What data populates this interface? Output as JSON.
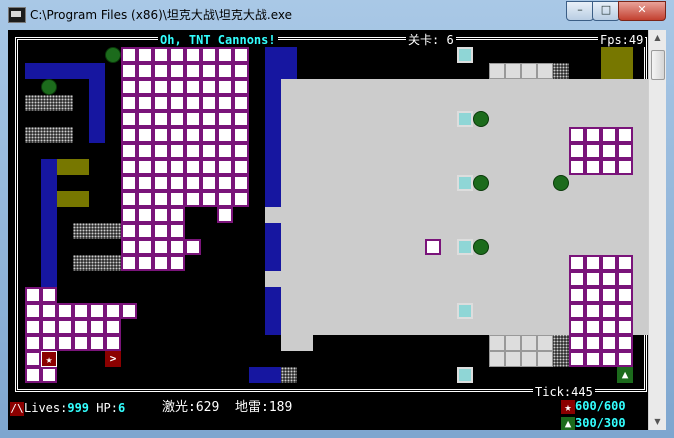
{
  "window": {
    "title": "C:\\Program Files (x86)\\坦克大战\\坦克大战.exe",
    "controls": {
      "minimize": "–",
      "maximize": "□",
      "close": "✕"
    }
  },
  "game": {
    "level_name": "Oh, TNT Cannons!",
    "level_label": "关卡:",
    "level_value": "6",
    "fps_text": "Fps:49",
    "tick_text": "Tick:445"
  },
  "status": {
    "lives_label": "Lives:",
    "lives_value": "999",
    "hp_label": "HP:",
    "hp_value": "6",
    "laser_text": "激光:629",
    "mine_text": "地雷:189",
    "star_ammo_text": "600/600",
    "tank_ammo_text": "300/300"
  },
  "colors": {
    "background": "#000000",
    "hud_cyan": "#33ffff",
    "brick_border": "#7a147a",
    "water": "#1616a0",
    "enemy_base": "#777700",
    "grass": "#1c6b1c",
    "player_tank": "#8b0000"
  },
  "icons": {
    "player_tank": "tank-icon",
    "star_powerup": "star-icon",
    "green_tank": "green-tank-icon"
  }
}
